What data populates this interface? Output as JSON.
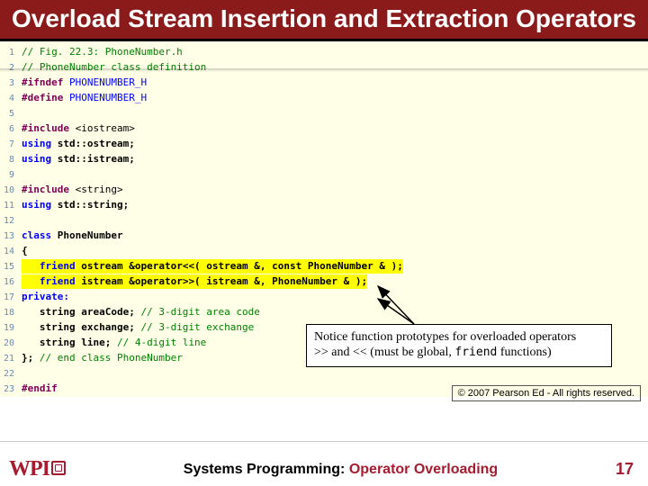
{
  "title": "Overload Stream Insertion and Extraction Operators",
  "code": {
    "l1": "// Fig. 22.3: PhoneNumber.h",
    "l2": "// PhoneNumber class definition",
    "l3a": "#ifndef",
    "l3b": " PHONENUMBER_H",
    "l4a": "#define",
    "l4b": " PHONENUMBER_H",
    "l6a": "#include ",
    "l6b": "<iostream>",
    "l7a": "using",
    "l7b": " std::ostream;",
    "l8a": "using",
    "l8b": " std::istream;",
    "l10a": "#include ",
    "l10b": "<string>",
    "l11a": "using",
    "l11b": " std::string;",
    "l13a": "class",
    "l13b": " PhoneNumber",
    "l14": "{",
    "l15a": "   friend",
    "l15b": " ostream &operator<<( ostream &, const PhoneNumber & );",
    "l16a": "   friend",
    "l16b": " istream &operator>>( istream &, PhoneNumber & );",
    "l17": "private:",
    "l18a": "   string areaCode; ",
    "l18b": "// 3-digit area code",
    "l19a": "   string exchange; ",
    "l19b": "// 3-digit exchange",
    "l20a": "   string line; ",
    "l20b": "// 4-digit line",
    "l21a": "}; ",
    "l21b": "// end class PhoneNumber",
    "l23": "#endif"
  },
  "callout": {
    "line1": "Notice function prototypes for overloaded operators",
    "line2a": ">> and << (must be global, ",
    "friend": "friend",
    "line2b": " functions)"
  },
  "copyright": "© 2007 Pearson Ed - All rights reserved.",
  "footer": {
    "logo_text": "WPI",
    "center_black": "Systems Programming:",
    "center_red": "  Operator Overloading",
    "page": "17"
  }
}
